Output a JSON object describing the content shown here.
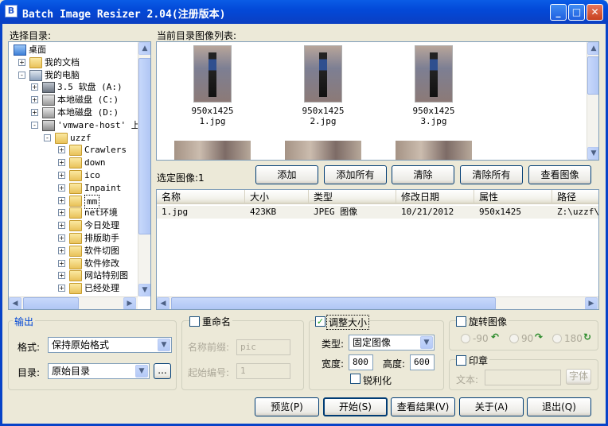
{
  "window": {
    "title": "Batch Image Resizer 2.04(注册版本)",
    "icon": "app-icon",
    "minimize": "_",
    "maximize": "□",
    "close": "✕"
  },
  "tree": {
    "label": "选择目录:",
    "items": [
      {
        "label": "桌面",
        "depth": 0,
        "icon": "desktop-icon",
        "expander": ""
      },
      {
        "label": "我的文档",
        "depth": 1,
        "icon": "folder-icon",
        "expander": "+"
      },
      {
        "label": "我的电脑",
        "depth": 1,
        "icon": "computer-icon",
        "expander": "-"
      },
      {
        "label": "3.5 软盘 (A:)",
        "depth": 2,
        "icon": "floppy-icon",
        "expander": "+"
      },
      {
        "label": "本地磁盘 (C:)",
        "depth": 2,
        "icon": "drive-icon",
        "expander": "+"
      },
      {
        "label": "本地磁盘 (D:)",
        "depth": 2,
        "icon": "drive-icon",
        "expander": "+"
      },
      {
        "label": "'vmware-host' 上的",
        "depth": 2,
        "icon": "network-drive-icon",
        "expander": "-"
      },
      {
        "label": "uzzf",
        "depth": 3,
        "icon": "folder-icon",
        "expander": "-"
      },
      {
        "label": "Crawlers",
        "depth": 4,
        "icon": "folder-icon",
        "expander": "+"
      },
      {
        "label": "down",
        "depth": 4,
        "icon": "folder-icon",
        "expander": "+"
      },
      {
        "label": "ico",
        "depth": 4,
        "icon": "folder-icon",
        "expander": "+"
      },
      {
        "label": "Inpaint",
        "depth": 4,
        "icon": "folder-icon",
        "expander": "+"
      },
      {
        "label": "mm",
        "depth": 4,
        "icon": "folder-icon",
        "expander": "+"
      },
      {
        "label": "net环境",
        "depth": 4,
        "icon": "folder-icon",
        "expander": "+"
      },
      {
        "label": "今日处理",
        "depth": 4,
        "icon": "folder-icon",
        "expander": "+"
      },
      {
        "label": "排版助手",
        "depth": 4,
        "icon": "folder-icon",
        "expander": "+"
      },
      {
        "label": "软件切图",
        "depth": 4,
        "icon": "folder-icon",
        "expander": "+"
      },
      {
        "label": "软件修改",
        "depth": 4,
        "icon": "folder-icon",
        "expander": "+"
      },
      {
        "label": "网站特别图",
        "depth": 4,
        "icon": "folder-icon",
        "expander": "+"
      },
      {
        "label": "已经处理",
        "depth": 4,
        "icon": "folder-icon",
        "expander": "+"
      }
    ]
  },
  "images": {
    "label": "当前目录图像列表:",
    "thumbs": [
      {
        "dims": "950x1425",
        "name": "1.jpg"
      },
      {
        "dims": "950x1425",
        "name": "2.jpg"
      },
      {
        "dims": "950x1425",
        "name": "3.jpg"
      }
    ]
  },
  "selected": {
    "label": "选定图像:1"
  },
  "actions": [
    "添加",
    "添加所有",
    "清除",
    "清除所有",
    "查看图像"
  ],
  "table": {
    "columns": [
      "名称",
      "大小",
      "类型",
      "修改日期",
      "属性",
      "路径"
    ],
    "rows": [
      [
        "1.jpg",
        "423KB",
        "JPEG 图像",
        "10/21/2012",
        "950x1425",
        "Z:\\uzzf\\"
      ]
    ]
  },
  "output": {
    "legend": "输出",
    "format_label": "格式:",
    "format_value": "保持原始格式",
    "dir_label": "目录:",
    "dir_value": "原始目录",
    "browse": "..."
  },
  "rename": {
    "legend": "重命名",
    "prefix_label": "名称前缀:",
    "prefix_value": "pic",
    "start_label": "起始编号:",
    "start_value": "1"
  },
  "resize": {
    "legend": "调整大小",
    "checked": true,
    "type_label": "类型:",
    "type_value": "固定图像",
    "width_label": "宽度:",
    "width_value": "800",
    "height_label": "高度:",
    "height_value": "600",
    "sharpen_label": "锐利化"
  },
  "rotate": {
    "legend": "旋转图像",
    "options": [
      "-90",
      "90",
      "180"
    ]
  },
  "stamp": {
    "legend": "印章",
    "text_label": "文本:",
    "font_button": "字体"
  },
  "footer": [
    "预览(P)",
    "开始(S)",
    "查看结果(V)",
    "关于(A)",
    "退出(Q)"
  ]
}
